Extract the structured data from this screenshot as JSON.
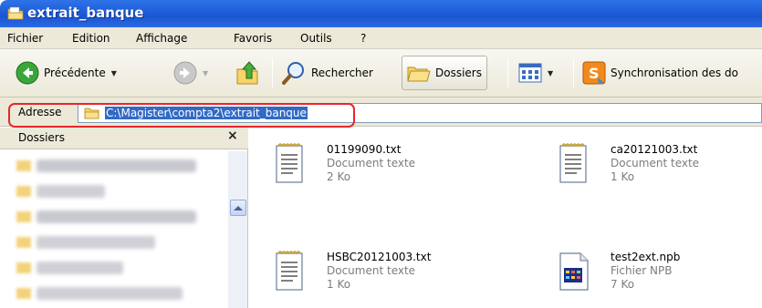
{
  "window": {
    "title": "extrait_banque"
  },
  "menu": [
    "Fichier",
    "Edition",
    "Affichage",
    "Favoris",
    "Outils",
    "?"
  ],
  "toolbar": {
    "back_label": "Précédente",
    "search_label": "Rechercher",
    "folders_label": "Dossiers",
    "sync_label": "Synchronisation des do"
  },
  "address": {
    "label": "Adresse",
    "path": "C:\\Magister\\compta2\\extrait_banque"
  },
  "folders_pane": {
    "title": "Dossiers",
    "close": "×"
  },
  "files": [
    {
      "name": "01199090.txt",
      "type": "Document texte",
      "size": "2 Ko",
      "icon": "text-file-icon"
    },
    {
      "name": "ca20121003.txt",
      "type": "Document texte",
      "size": "1 Ko",
      "icon": "text-file-icon"
    },
    {
      "name": "HSBC20121003.txt",
      "type": "Document texte",
      "size": "1 Ko",
      "icon": "text-file-icon"
    },
    {
      "name": "test2ext.npb",
      "type": "Fichier NPB",
      "size": "7 Ko",
      "icon": "npb-file-icon"
    }
  ],
  "colors": {
    "title_bar": "#1f5fdc",
    "selection": "#316ac5",
    "highlight_box": "#e8262b"
  }
}
